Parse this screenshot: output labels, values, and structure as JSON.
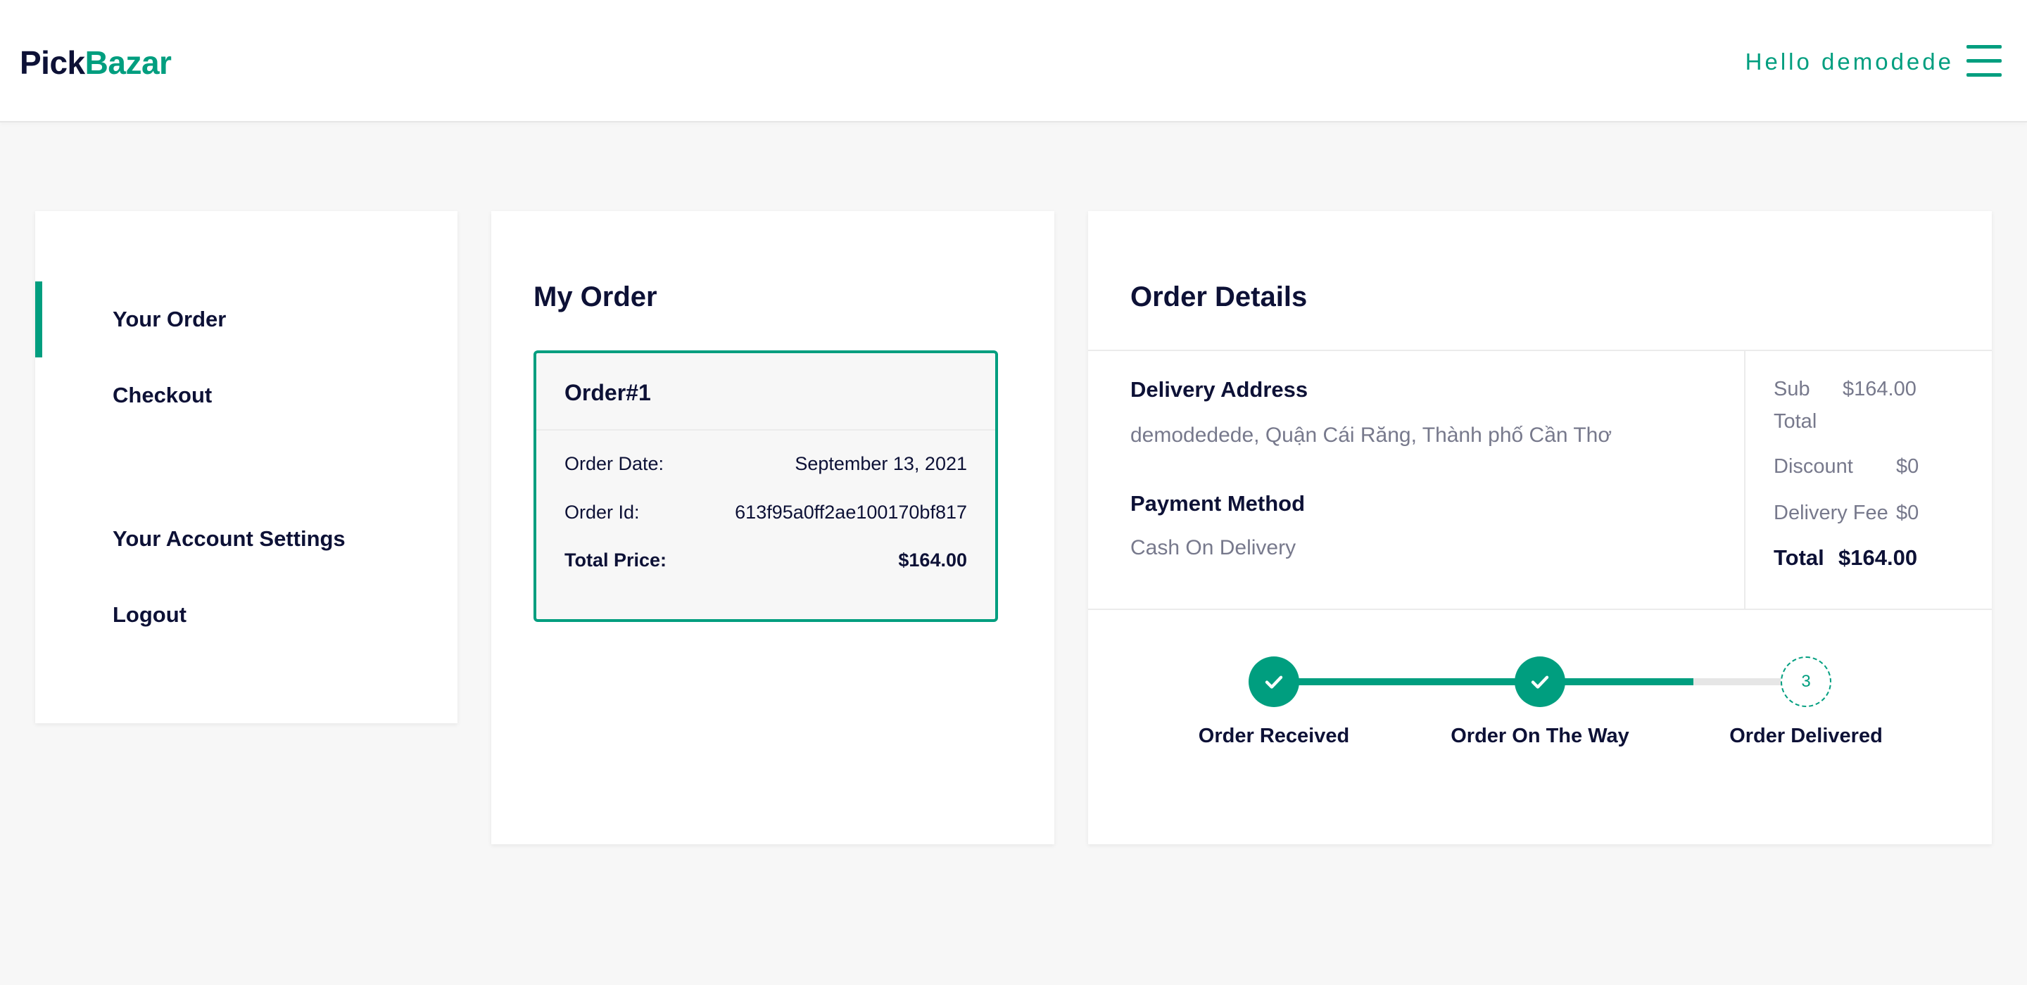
{
  "header": {
    "logo_part1": "Pick",
    "logo_part2": "Bazar",
    "greeting": "Hello demodede",
    "menu_icon": "hamburger-menu-icon"
  },
  "sidebar": {
    "items": [
      {
        "label": "Your Order",
        "active": true
      },
      {
        "label": "Checkout",
        "active": false
      },
      {
        "label": "Your Account Settings",
        "active": false
      },
      {
        "label": "Logout",
        "active": false
      }
    ]
  },
  "my_order": {
    "title": "My Order",
    "order": {
      "title": "Order#1",
      "date_label": "Order Date:",
      "date_value": "September 13, 2021",
      "id_label": "Order Id:",
      "id_value": "613f95a0ff2ae100170bf817",
      "total_label": "Total Price:",
      "total_value": "$164.00"
    }
  },
  "order_details": {
    "title": "Order Details",
    "delivery_address_label": "Delivery Address",
    "delivery_address": "demodedede, Quận Cái Răng, Thành phố Cần Thơ",
    "payment_method_label": "Payment Method",
    "payment_method": "Cash On Delivery",
    "summary": {
      "subtotal_label_1": "Sub",
      "subtotal_label_2": "Total",
      "subtotal_value": "$164.00",
      "discount_label": "Discount",
      "discount_value": "$0",
      "delivery_fee_label": "Delivery Fee",
      "delivery_fee_value": "$0",
      "total_label": "Total",
      "total_value": "$164.00"
    },
    "progress": {
      "steps": [
        {
          "label": "Order Received",
          "status": "done",
          "icon": "check-icon"
        },
        {
          "label": "Order On The Way",
          "status": "done",
          "icon": "check-icon"
        },
        {
          "label": "Order Delivered",
          "status": "pending",
          "number": "3"
        }
      ]
    }
  },
  "colors": {
    "accent": "#009e7f",
    "heading": "#0d1136",
    "muted": "#77798c",
    "background": "#f7f7f7"
  }
}
